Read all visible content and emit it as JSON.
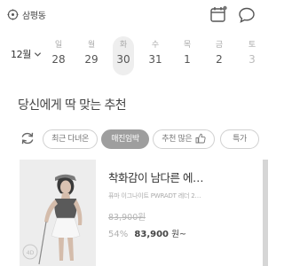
{
  "header": {
    "location": "삼평동",
    "icons": [
      "location-pin-icon",
      "calendar-icon",
      "chat-bubble-icon"
    ]
  },
  "date_bar": {
    "month_label": "12월",
    "days": [
      {
        "dow": "일",
        "num": "28",
        "selected": false,
        "dim": false
      },
      {
        "dow": "월",
        "num": "29",
        "selected": false,
        "dim": false
      },
      {
        "dow": "화",
        "num": "30",
        "selected": true,
        "dim": false
      },
      {
        "dow": "수",
        "num": "31",
        "selected": false,
        "dim": false
      },
      {
        "dow": "목",
        "num": "1",
        "selected": false,
        "dim": false
      },
      {
        "dow": "금",
        "num": "2",
        "selected": false,
        "dim": false
      },
      {
        "dow": "토",
        "num": "3",
        "selected": false,
        "dim": true
      }
    ]
  },
  "section": {
    "title": "당신에게 딱 맞는 추천"
  },
  "filters": [
    {
      "label": "최근 다녀온",
      "active": false
    },
    {
      "label": "매진임박",
      "active": true
    },
    {
      "label": "추천 많은",
      "active": false
    },
    {
      "label": "특가",
      "active": false
    }
  ],
  "product": {
    "title": "착화감이 남다른 에…",
    "subtitle": "퓨마 이그나이트 PWRADT 레더 2…",
    "original_price": "83,900원",
    "discount": "54%",
    "price": "83,900",
    "unit": "원~"
  },
  "colors": {
    "selected_chip": "#9e9e9e",
    "card_bg": "#ececec"
  }
}
